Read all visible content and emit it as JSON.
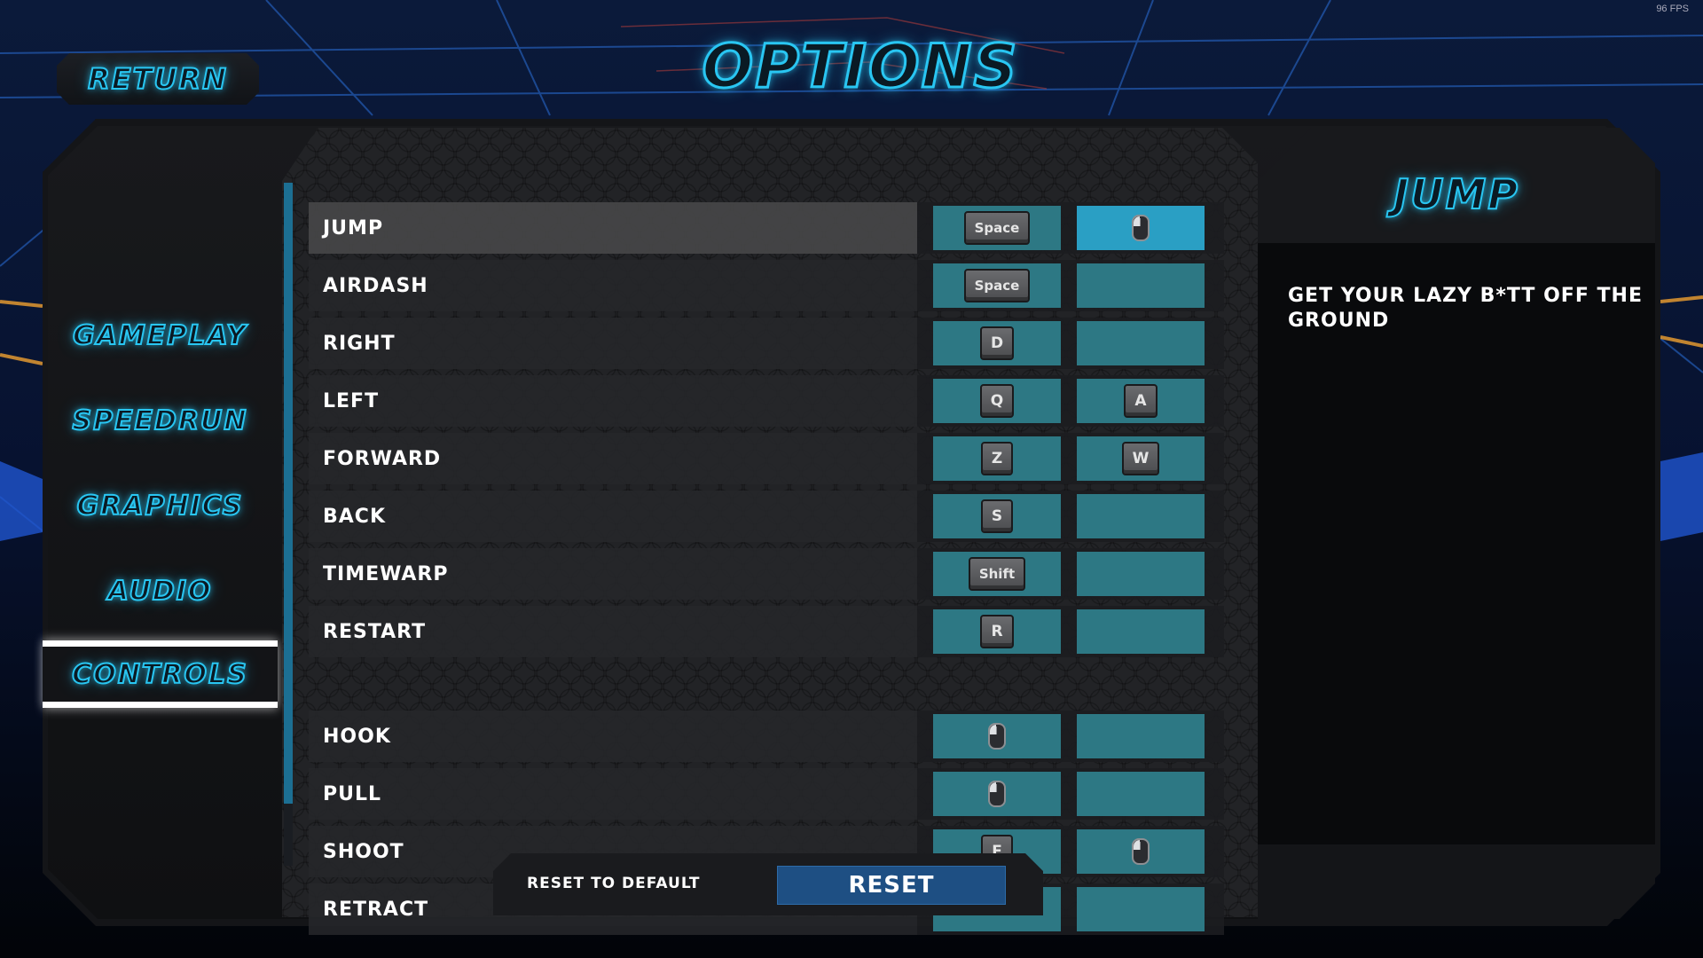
{
  "fps": "96 FPS",
  "header": {
    "title": "OPTIONS",
    "return_label": "RETURN"
  },
  "sidebar": {
    "items": [
      {
        "label": "GAMEPLAY",
        "active": false
      },
      {
        "label": "SPEEDRUN",
        "active": false
      },
      {
        "label": "GRAPHICS",
        "active": false
      },
      {
        "label": "AUDIO",
        "active": false
      },
      {
        "label": "CONTROLS",
        "active": true
      }
    ]
  },
  "controls": [
    {
      "action": "JUMP",
      "primary": {
        "type": "key",
        "text": "Space"
      },
      "secondary": {
        "type": "mouse"
      },
      "selected": true
    },
    {
      "action": "AIRDASH",
      "primary": {
        "type": "key",
        "text": "Space"
      },
      "secondary": null
    },
    {
      "action": "RIGHT",
      "primary": {
        "type": "key",
        "text": "D"
      },
      "secondary": null
    },
    {
      "action": "LEFT",
      "primary": {
        "type": "key",
        "text": "Q"
      },
      "secondary": {
        "type": "key",
        "text": "A"
      }
    },
    {
      "action": "FORWARD",
      "primary": {
        "type": "key",
        "text": "Z"
      },
      "secondary": {
        "type": "key",
        "text": "W"
      }
    },
    {
      "action": "BACK",
      "primary": {
        "type": "key",
        "text": "S"
      },
      "secondary": null
    },
    {
      "action": "TIMEWARP",
      "primary": {
        "type": "key",
        "text": "Shift"
      },
      "secondary": null
    },
    {
      "action": "RESTART",
      "primary": {
        "type": "key",
        "text": "R"
      },
      "secondary": null
    },
    {
      "action": "HOOK",
      "primary": {
        "type": "mouse"
      },
      "secondary": null
    },
    {
      "action": "PULL",
      "primary": {
        "type": "mouse"
      },
      "secondary": null
    },
    {
      "action": "SHOOT",
      "primary": {
        "type": "key",
        "text": "E"
      },
      "secondary": {
        "type": "mouse"
      }
    },
    {
      "action": "RETRACT",
      "primary": null,
      "secondary": null
    }
  ],
  "reset": {
    "label": "RESET TO DEFAULT",
    "button": "RESET"
  },
  "detail": {
    "title": "JUMP",
    "description": "GET YOUR LAZY B*TT OFF THE GROUND"
  },
  "colors": {
    "neon_accent": "#29c6f2",
    "slot": "#2d7884",
    "slot_active": "#2a9fc4",
    "reset_button": "#1e4f83",
    "scrollbar": "#1c6f93"
  }
}
